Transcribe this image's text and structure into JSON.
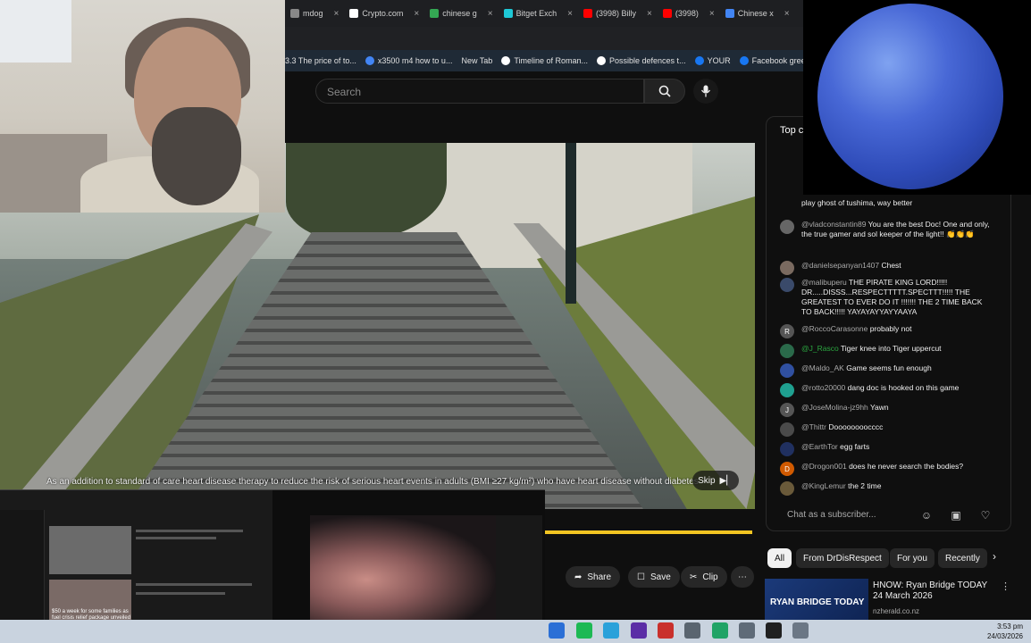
{
  "browser": {
    "tabs": [
      {
        "label": "mdog",
        "color": "#888888"
      },
      {
        "label": "Crypto.com",
        "color": "#ffffff"
      },
      {
        "label": "chinese g",
        "color": "#34a853"
      },
      {
        "label": "Bitget Exch",
        "color": "#1ec8d6"
      },
      {
        "label": "(3998) Billy",
        "color": "#ff0000"
      },
      {
        "label": "(3998)",
        "color": "#ff0000"
      },
      {
        "label": "Chinese x",
        "color": "#4285f4"
      }
    ],
    "bookmarks": [
      {
        "label": "3.3 The price of to...",
        "color": ""
      },
      {
        "label": "x3500 m4 how to u...",
        "color": "#4285f4"
      },
      {
        "label": "New Tab",
        "color": ""
      },
      {
        "label": "Timeline of Roman...",
        "color": "#ffffff"
      },
      {
        "label": "Possible defences t...",
        "color": "#ffffff"
      },
      {
        "label": "YOUR",
        "color": "#1877f2"
      },
      {
        "label": "Facebook green",
        "color": "#1877f2"
      }
    ]
  },
  "youtube": {
    "search_placeholder": "Search",
    "ad_text": "As an addition to standard of care heart disease therapy to reduce the risk of serious heart events in adults (BMI ≥27 kg/m²) who have heart disease without diabetes",
    "skip_label": "Skip",
    "ad_progress": 1.0,
    "actions": {
      "share": "Share",
      "save": "Save",
      "clip": "Clip",
      "more": "⋯"
    }
  },
  "chat": {
    "header": "Top c",
    "input_placeholder": "Chat as a subscriber...",
    "messages": [
      {
        "user": "",
        "text": "play ghost of tushima, way better",
        "avatar": "",
        "color": "#555555",
        "green": false
      },
      {
        "user": "@vladconstantin89",
        "text": "You are the best Doc! One and only, the true gamer and sol keeper of the light!! 👏👏👏",
        "avatar": "",
        "color": "#666666",
        "green": false
      },
      {
        "user": "@danielsepanyan1407",
        "text": "Chest",
        "avatar": "",
        "color": "#7a6a60",
        "green": false
      },
      {
        "user": "@malibuperu",
        "text": "THE PIRATE KING LORD!!!!! DR.....DISSS...RESPECTTTTT.SPECTTT!!!!! THE GREATEST TO EVER DO IT !!!!!!! THE 2 TIME BACK TO BACK!!!!! YAYAYAYYAYYAAYA",
        "avatar": "",
        "color": "#3a4a6a",
        "green": false
      },
      {
        "user": "@RoccoCarasonne",
        "text": "probably not",
        "avatar": "R",
        "color": "#555555",
        "green": false
      },
      {
        "user": "@J_Rasco",
        "text": "Tiger knee into Tiger uppercut",
        "avatar": "",
        "color": "#2a6a4a",
        "green": true
      },
      {
        "user": "@Maldo_AK",
        "text": "Game seems fun enough",
        "avatar": "",
        "color": "#3050a0",
        "green": false
      },
      {
        "user": "@rotto20000",
        "text": "dang doc is hooked on this game",
        "avatar": "",
        "color": "#1fa090",
        "green": false
      },
      {
        "user": "@JoseMolina-jz9hh",
        "text": "Yawn",
        "avatar": "J",
        "color": "#555555",
        "green": false
      },
      {
        "user": "@Thittr",
        "text": "Doooooooocccc",
        "avatar": "",
        "color": "#4a4a4a",
        "green": false
      },
      {
        "user": "@EarthTor",
        "text": "egg farts",
        "avatar": "",
        "color": "#203060",
        "green": false
      },
      {
        "user": "@Drogon001",
        "text": "does he never search the bodies?",
        "avatar": "D",
        "color": "#d05a00",
        "green": false
      },
      {
        "user": "@KingLemur",
        "text": "the 2 time",
        "avatar": "",
        "color": "#6a5a3a",
        "green": false
      }
    ]
  },
  "chips": [
    "All",
    "From DrDisRespect",
    "For you",
    "Recently"
  ],
  "recommendation": {
    "title": "HNOW: Ryan Bridge TODAY 24 March 2026",
    "channel": "nzherald.co.nz",
    "thumb_text": "RYAN BRIDGE TODAY"
  },
  "thumbnail_overlay": {
    "caption": "$50 a week for some families as fuel crisis relief package unveiled"
  },
  "taskbar": {
    "time": "3:53 pm",
    "date": "24/03/2026",
    "icons": [
      {
        "name": "files",
        "color": "#2b6fd6"
      },
      {
        "name": "chat",
        "color": "#1db954"
      },
      {
        "name": "telegram",
        "color": "#2aa1da"
      },
      {
        "name": "app-purple",
        "color": "#5b2ea6"
      },
      {
        "name": "app-red",
        "color": "#c9302c"
      },
      {
        "name": "controller",
        "color": "#5a6570"
      },
      {
        "name": "browser-green",
        "color": "#21a366"
      },
      {
        "name": "settings",
        "color": "#5f6b78"
      },
      {
        "name": "obs",
        "color": "#202020"
      },
      {
        "name": "plus",
        "color": "#6b7785"
      }
    ]
  }
}
